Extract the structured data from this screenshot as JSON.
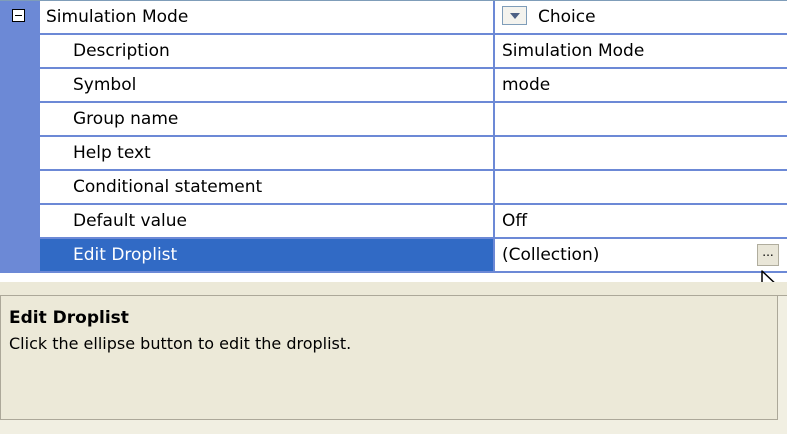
{
  "grid": {
    "category": {
      "name": "Simulation Mode",
      "value": "Choice"
    },
    "rows": [
      {
        "name": "Description",
        "value": "Simulation Mode"
      },
      {
        "name": "Symbol",
        "value": "mode"
      },
      {
        "name": "Group name",
        "value": ""
      },
      {
        "name": "Help text",
        "value": ""
      },
      {
        "name": "Conditional statement",
        "value": ""
      },
      {
        "name": "Default value",
        "value": "Off"
      },
      {
        "name": "Edit Droplist",
        "value": "(Collection)"
      }
    ],
    "selected_row": "Edit Droplist",
    "ellipsis_label": "..."
  },
  "help": {
    "title": "Edit Droplist",
    "description": "Click the ellipse button to edit the droplist."
  },
  "colors": {
    "gutter": "#6c89d6",
    "selection": "#316ac5",
    "grid_line": "#6c89d6",
    "panel_bg": "#ece9d8"
  },
  "icons": {
    "expander": "collapse-minus-icon",
    "dropdown": "dropdown-arrow-icon",
    "cursor": "mouse-pointer-icon"
  }
}
